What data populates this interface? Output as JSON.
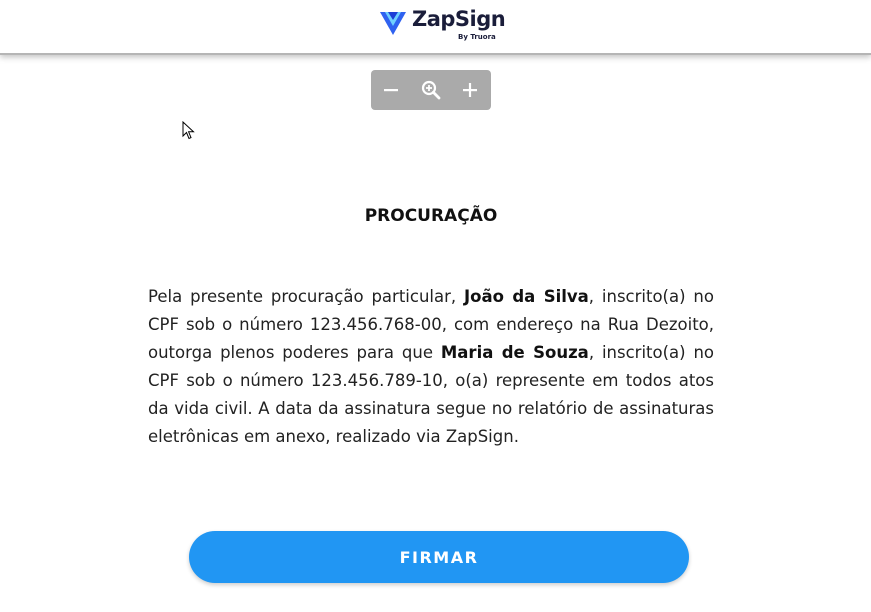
{
  "header": {
    "brand_name": "ZapSign",
    "brand_byline": "By Truora",
    "brand_color": "#2f62f0"
  },
  "zoom_toolbar": {
    "zoom_out_icon": "minus-icon",
    "zoom_fit_icon": "zoom-magnifier-icon",
    "zoom_in_icon": "plus-icon"
  },
  "document": {
    "title": "PROCURAÇÃO",
    "body": {
      "p1": "Pela presente procuração particular, ",
      "grantor": "João da Silva",
      "p2": ", inscrito(a) no CPF sob o número 123.456.768-00, com endereço na Rua Dezoito, outorga plenos poderes para que ",
      "grantee": "Maria de Souza",
      "p3": ", inscrito(a) no CPF sob o número 123.456.789-10, o(a) represente em todos atos da vida civil. A data da assinatura segue no relatório de assinaturas eletrônicas em anexo, realizado via ZapSign."
    }
  },
  "actions": {
    "sign_label": "FIRMAR",
    "sign_color": "#2196f3"
  }
}
